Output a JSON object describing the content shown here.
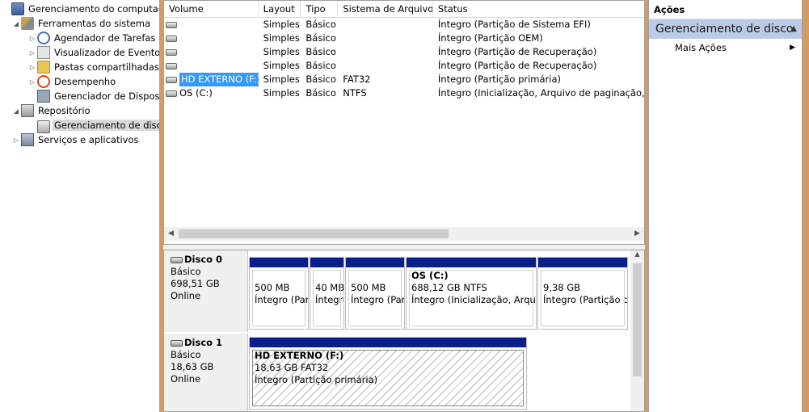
{
  "tree": {
    "items": [
      {
        "label": "Gerenciamento do computador",
        "arrow": "",
        "icon": "computer-management-icon"
      },
      {
        "label": "Ferramentas do sistema",
        "arrow": "◢",
        "icon": "system-tools-icon"
      },
      {
        "label": "Agendador de Tarefas",
        "arrow": "▷",
        "icon": "task-scheduler-icon"
      },
      {
        "label": "Visualizador de Eventos",
        "arrow": "▷",
        "icon": "event-viewer-icon"
      },
      {
        "label": "Pastas compartilhadas",
        "arrow": "▷",
        "icon": "shared-folders-icon"
      },
      {
        "label": "Desempenho",
        "arrow": "▷",
        "icon": "performance-icon"
      },
      {
        "label": "Gerenciador de Dispositivos",
        "arrow": "",
        "icon": "device-manager-icon"
      },
      {
        "label": "Repositório",
        "arrow": "◢",
        "icon": "storage-icon"
      },
      {
        "label": "Gerenciamento de disco",
        "arrow": "",
        "icon": "disk-management-icon"
      },
      {
        "label": "Serviços e aplicativos",
        "arrow": "▷",
        "icon": "services-icon"
      }
    ]
  },
  "volumes": {
    "columns": [
      "Volume",
      "Layout",
      "Tipo",
      "Sistema de Arquivos",
      "Status"
    ],
    "rows": [
      {
        "volume": "",
        "layout": "Simples",
        "tipo": "Básico",
        "fs": "",
        "status": "Íntegro (Partição de Sistema EFI)"
      },
      {
        "volume": "",
        "layout": "Simples",
        "tipo": "Básico",
        "fs": "",
        "status": "Íntegro (Partição OEM)"
      },
      {
        "volume": "",
        "layout": "Simples",
        "tipo": "Básico",
        "fs": "",
        "status": "Íntegro (Partição de Recuperação)"
      },
      {
        "volume": "",
        "layout": "Simples",
        "tipo": "Básico",
        "fs": "",
        "status": "Íntegro (Partição de Recuperação)"
      },
      {
        "volume": "HD EXTERNO (F:)",
        "layout": "Simples",
        "tipo": "Básico",
        "fs": "FAT32",
        "status": "Íntegro (Partição primária)"
      },
      {
        "volume": "OS (C:)",
        "layout": "Simples",
        "tipo": "Básico",
        "fs": "NTFS",
        "status": "Íntegro (Inicialização, Arquivo de paginação, Despejo de Memória)"
      }
    ]
  },
  "disks": [
    {
      "name": "Disco 0",
      "type": "Básico",
      "size": "698,51 GB",
      "state": "Online",
      "partitions": [
        {
          "title": "",
          "size": "500 MB",
          "status": "Íntegro (Partição de Sistema EFI)"
        },
        {
          "title": "",
          "size": "40 MB",
          "status": "Íntegro (Partição OEM)"
        },
        {
          "title": "",
          "size": "500 MB",
          "status": "Íntegro (Partição de Recuperação)"
        },
        {
          "title": "OS  (C:)",
          "size": "688,12 GB NTFS",
          "status": "Íntegro (Inicialização, Arquivo de paginação)"
        },
        {
          "title": "",
          "size": "9,38 GB",
          "status": "Íntegro (Partição de Recuperação)"
        }
      ]
    },
    {
      "name": "Disco 1",
      "type": "Básico",
      "size": "18,63 GB",
      "state": "Online",
      "partitions": [
        {
          "title": "HD EXTERNO  (F:)",
          "size": "18,63 GB FAT32",
          "status": "Íntegro (Partição primária)"
        }
      ]
    }
  ],
  "actions": {
    "title": "Ações",
    "section": "Gerenciamento de disco",
    "more": "Mais Ações"
  },
  "colors": {
    "partition_band": "#0a1f8c",
    "selection": "#3399ff",
    "action_section": "#b9cbe8"
  }
}
